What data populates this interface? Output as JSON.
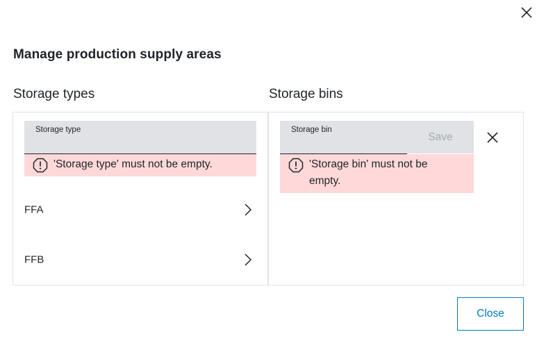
{
  "dialog": {
    "title": "Manage production supply areas",
    "close_icon": "close-icon",
    "close_button_label": "Close"
  },
  "storage_types": {
    "heading": "Storage types",
    "field_label": "Storage type",
    "field_value": "",
    "error_icon": "warning-octagon-icon",
    "error_message": "'Storage type' must not be empty.",
    "items": [
      {
        "label": "FFA",
        "icon": "chevron-right-icon"
      },
      {
        "label": "FFB",
        "icon": "chevron-right-icon"
      }
    ]
  },
  "storage_bins": {
    "heading": "Storage bins",
    "field_label": "Storage bin",
    "field_value": "",
    "save_label": "Save",
    "clear_icon": "close-icon",
    "error_icon": "warning-octagon-icon",
    "error_message": "'Storage bin' must not be empty."
  },
  "colors": {
    "field_bg": "#e0e2e5",
    "error_bg": "#ffd9d9",
    "accent": "#007bc0",
    "text": "#1f2328",
    "disabled_text": "#a4abb3"
  }
}
